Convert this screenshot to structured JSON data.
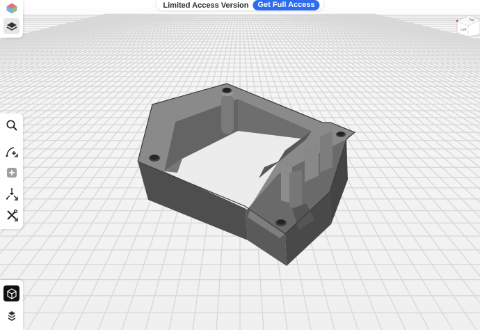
{
  "banner": {
    "text": "Limited Access Version",
    "button_label": "Get Full Access",
    "button_color": "#2d6bef"
  },
  "nav_cube": {
    "faces": [
      "Top",
      "Left"
    ]
  },
  "toolbar": {
    "top_icons": [
      "viewer-logo-icon",
      "layers-icon"
    ],
    "tools": [
      "search-icon",
      "measure-arc-icon",
      "add-icon",
      "explode-icon",
      "tools-icon"
    ],
    "bottom_icons": [
      "model-view-icon",
      "section-stack-icon"
    ]
  },
  "colors": {
    "background": "#f4f4f4",
    "grid": "#d6d6d6",
    "model": "#5c5c5c"
  }
}
